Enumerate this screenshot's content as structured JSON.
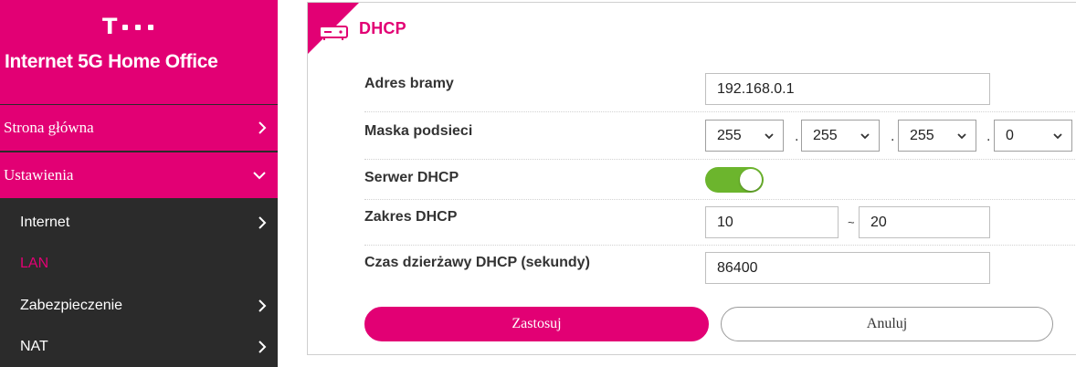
{
  "brand": {
    "logo_letter": "T",
    "title": "Internet 5G Home Office"
  },
  "nav": {
    "main": [
      {
        "label": "Strona główna",
        "chevron": "›"
      },
      {
        "label": "Ustawienia",
        "chevron": "⌄"
      }
    ],
    "sub": [
      {
        "label": "Internet",
        "chevron": "›"
      },
      {
        "label": "LAN"
      },
      {
        "label": "Zabezpieczenie",
        "chevron": "›"
      },
      {
        "label": "NAT",
        "chevron": "›"
      }
    ]
  },
  "panel": {
    "title": "DHCP",
    "title_icon": "router-icon"
  },
  "form": {
    "gateway": {
      "label": "Adres bramy",
      "value": "192.168.0.1"
    },
    "subnet": {
      "label": "Maska podsieci",
      "octets": [
        "255",
        "255",
        "255",
        "0"
      ],
      "separator": "."
    },
    "dhcp_server": {
      "label": "Serwer DHCP",
      "enabled": true
    },
    "range": {
      "label": "Zakres DHCP",
      "start": "10",
      "separator": "~",
      "end": "20"
    },
    "lease": {
      "label": "Czas dzierżawy DHCP (sekundy)",
      "value": "86400"
    }
  },
  "buttons": {
    "apply": "Zastosuj",
    "cancel": "Anuluj"
  },
  "colors": {
    "accent": "#e20074",
    "sidebar_dark": "#2b2b2b",
    "toggle_on": "#6cb52d"
  }
}
